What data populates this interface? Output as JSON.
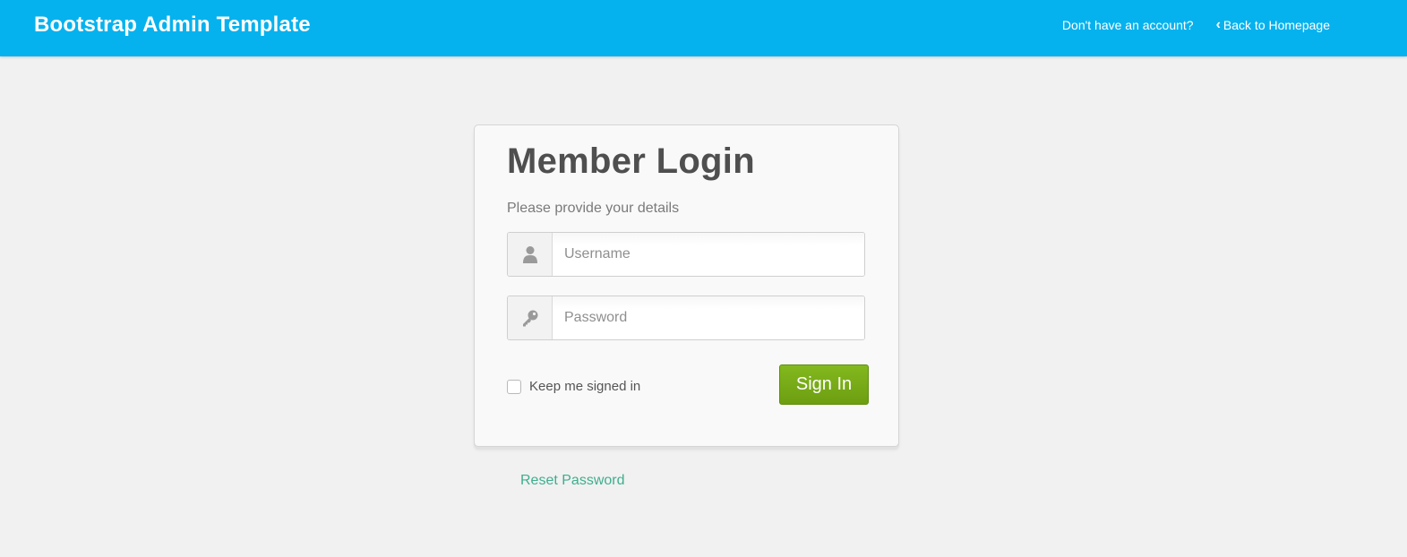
{
  "header": {
    "brand": "Bootstrap Admin Template",
    "nav": {
      "signup_link": "Don't have an account?",
      "back_link": "Back to Homepage",
      "back_icon": "chevron-left-icon"
    },
    "bg_color": "#06b2ee"
  },
  "login": {
    "title": "Member Login",
    "subtitle": "Please provide your details",
    "username": {
      "placeholder": "Username",
      "value": "",
      "icon": "user-icon"
    },
    "password": {
      "placeholder": "Password",
      "value": "",
      "icon": "key-icon"
    },
    "remember_label": "Keep me signed in",
    "remember_checked": false,
    "submit_label": "Sign In",
    "submit_color": "#7aab17"
  },
  "footer": {
    "reset_link": "Reset Password",
    "reset_color": "#3fae8e"
  }
}
